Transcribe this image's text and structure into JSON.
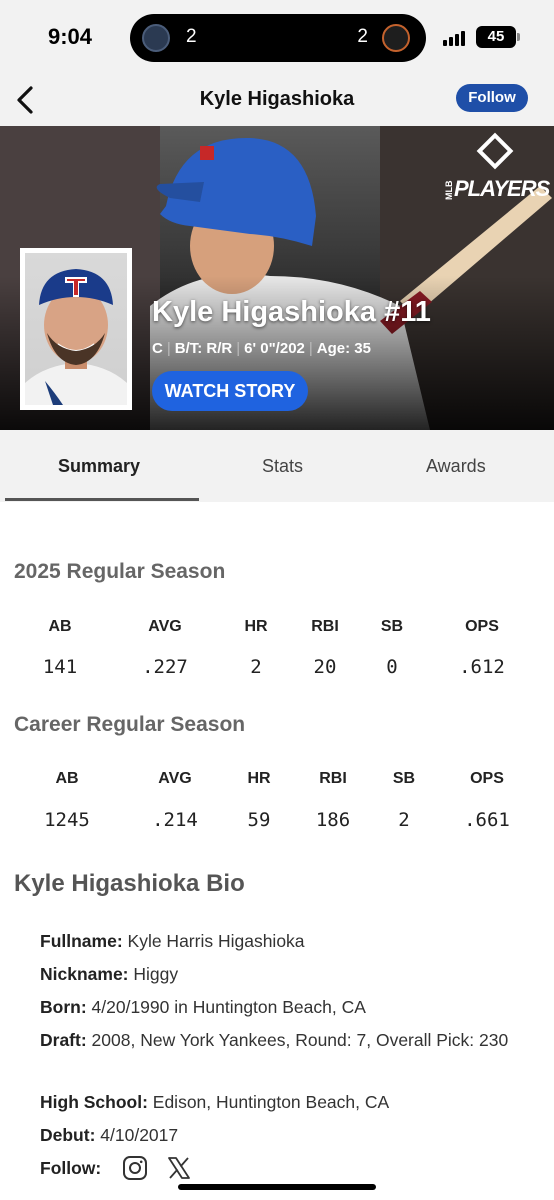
{
  "status_bar": {
    "time": "9:04",
    "live_activity": {
      "home_score": "2",
      "away_score": "2"
    },
    "battery": "45"
  },
  "header": {
    "title": "Kyle Higashioka",
    "follow_label": "Follow"
  },
  "hero": {
    "brand_mlb": "MLB",
    "brand_players": "PLAYERS",
    "player_name": "Kyle Higashioka #11",
    "position": "C",
    "bats_throws": "B/T: R/R",
    "height_weight": "6' 0\"/202",
    "age": "Age: 35",
    "watch_story_label": "WATCH STORY"
  },
  "tabs": [
    {
      "label": "Summary",
      "active": true
    },
    {
      "label": "Stats",
      "active": false
    },
    {
      "label": "Awards",
      "active": false
    }
  ],
  "season_2025": {
    "title": "2025 Regular Season",
    "labels": [
      "AB",
      "AVG",
      "HR",
      "RBI",
      "SB",
      "OPS"
    ],
    "values": [
      "141",
      ".227",
      "2",
      "20",
      "0",
      ".612"
    ]
  },
  "career": {
    "title": "Career Regular Season",
    "labels": [
      "AB",
      "AVG",
      "HR",
      "RBI",
      "SB",
      "OPS"
    ],
    "values": [
      "1245",
      ".214",
      "59",
      "186",
      "2",
      ".661"
    ]
  },
  "bio": {
    "title": "Kyle Higashioka Bio",
    "fullname_label": "Fullname:",
    "fullname": "Kyle Harris Higashioka",
    "nickname_label": "Nickname:",
    "nickname": "Higgy",
    "born_label": "Born:",
    "born": "4/20/1990 in Huntington Beach, CA",
    "draft_label": "Draft:",
    "draft": "2008, New York Yankees, Round: 7, Overall Pick: 230",
    "high_school_label": "High School:",
    "high_school": "Edison, Huntington Beach, CA",
    "debut_label": "Debut:",
    "debut": "4/10/2017",
    "follow_label": "Follow:",
    "social_icons": [
      "instagram-icon",
      "x-icon"
    ]
  },
  "colors": {
    "accent_blue": "#1f4fa8",
    "watch_story_blue": "#1f63e0",
    "section_title_gray": "#666666"
  }
}
